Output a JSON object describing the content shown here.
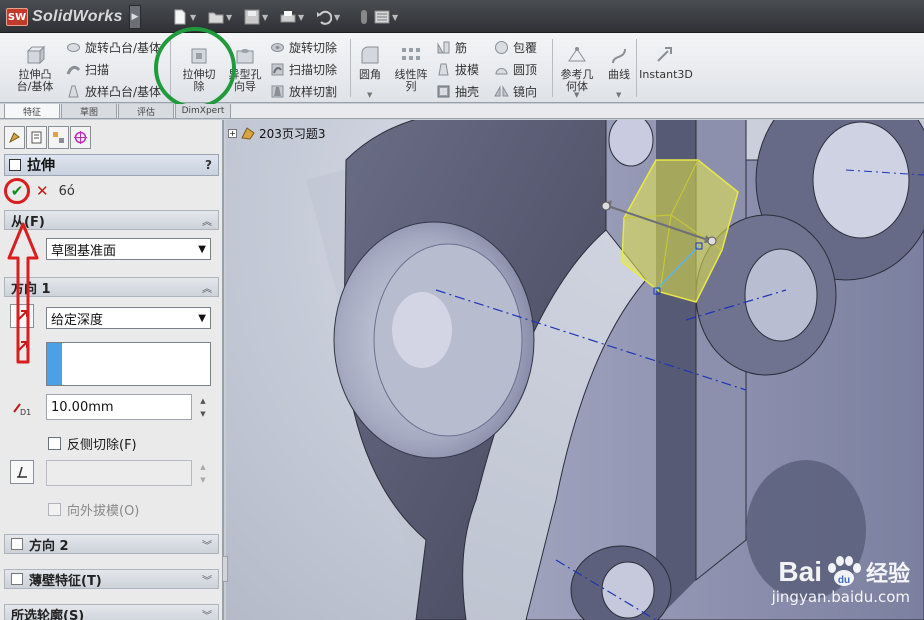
{
  "app": {
    "logo_badge": "SW",
    "name": "SolidWorks"
  },
  "commandmanager": {
    "big": [
      {
        "id": "extrude-boss",
        "label": "拉伸凸\n台/基体"
      },
      {
        "id": "extrude-cut",
        "label": "拉伸切\n除"
      },
      {
        "id": "hole-wizard",
        "label": "异型孔\n向导"
      },
      {
        "id": "fillet",
        "label": "圆角"
      },
      {
        "id": "linear-pattern",
        "label": "线性阵\n列"
      },
      {
        "id": "ref-geometry",
        "label": "参考几\n何体"
      },
      {
        "id": "curves",
        "label": "曲线"
      },
      {
        "id": "instant3d",
        "label": "Instant3D"
      }
    ],
    "small": {
      "revolve_boss": "旋转凸台/基体",
      "sweep": "扫描",
      "loft": "放样凸台/基体",
      "revolve_cut": "旋转切除",
      "swept_cut": "扫描切除",
      "lofted_cut": "放样切割",
      "rib": "筋",
      "draft": "拔模",
      "shell": "抽壳",
      "wrap": "包覆",
      "dome": "圆顶",
      "mirror": "镜向"
    },
    "tabs": [
      "特征",
      "草图",
      "评估",
      "DimXpert"
    ]
  },
  "property_manager": {
    "title": "拉伸",
    "help": "?",
    "from_group": {
      "title": "从(F)",
      "value": "草图基准面"
    },
    "direction1": {
      "title": "方向 1",
      "end_condition": "给定深度",
      "depth": "10.00mm",
      "flip_side_cut": "反侧切除(F)",
      "draft_outward": "向外拔模(O)"
    },
    "direction2": {
      "title": "方向 2"
    },
    "thin_feature": {
      "title": "薄壁特征(T)"
    },
    "selected_contours": {
      "title": "所选轮廓(S)"
    }
  },
  "tree": {
    "node": "203页习题3"
  },
  "watermark": {
    "brand": "Bai",
    "brand_cn": "经验",
    "url": "jingyan.baidu.com",
    "paw_tail": "du"
  },
  "colors": {
    "annot_green": "#1f9a3c",
    "annot_red": "#d81e1e",
    "model_face": "#5c5f78",
    "preview_yellow": "#e8e84a",
    "sketch_blue": "#1b35b8"
  }
}
